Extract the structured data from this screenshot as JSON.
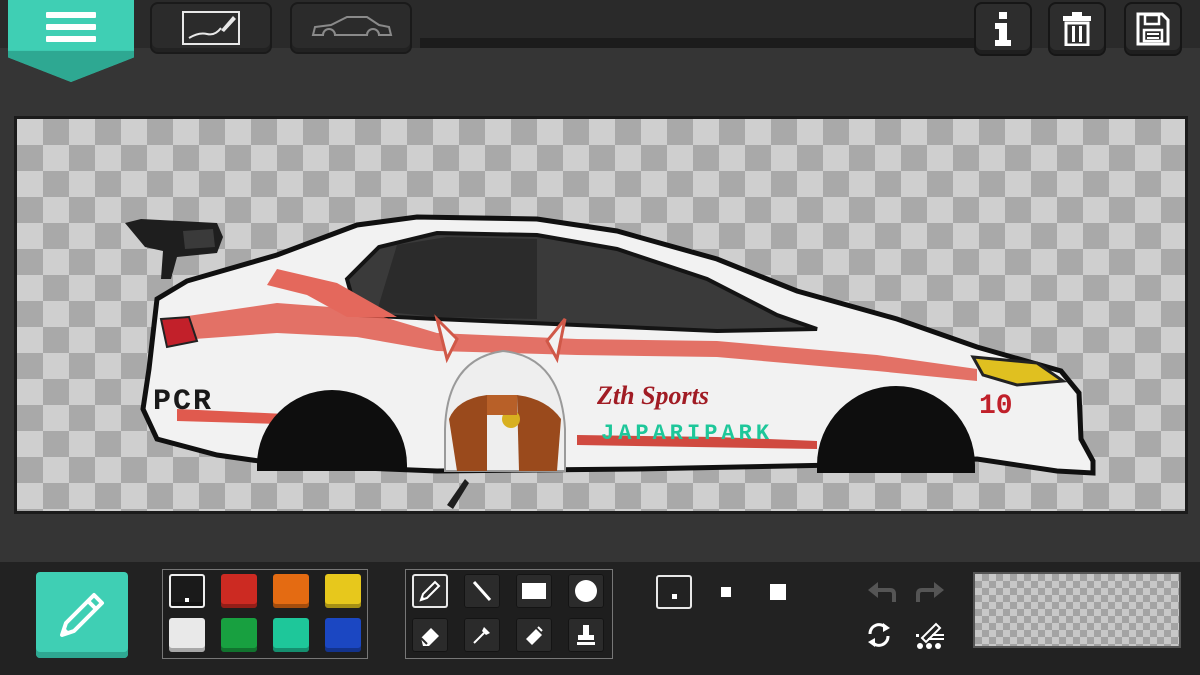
{
  "app": {
    "accent_color": "#3fcfb4",
    "background_color": "#353535"
  },
  "toolbar": {
    "menu_icon": "hamburger-menu-icon",
    "buttons": [
      {
        "name": "draw-mode",
        "icon": "line-drawing-icon"
      },
      {
        "name": "car-template",
        "icon": "car-outline-icon"
      },
      {
        "name": "info",
        "icon": "info-icon"
      },
      {
        "name": "delete",
        "icon": "trash-icon"
      },
      {
        "name": "save",
        "icon": "floppy-disk-icon"
      }
    ]
  },
  "canvas": {
    "background": "transparent-checkerboard",
    "livery": {
      "sponsor_text": "Zth Sports",
      "side_text": "JAPARIPARK",
      "rear_text": "PCR",
      "car_number": "10"
    }
  },
  "palette": {
    "colors": [
      {
        "name": "black",
        "hex": "#1a1a1a",
        "selected": true
      },
      {
        "name": "red",
        "hex": "#cc2a22",
        "selected": false
      },
      {
        "name": "orange",
        "hex": "#e46b12",
        "selected": false
      },
      {
        "name": "yellow",
        "hex": "#e7c81c",
        "selected": false
      },
      {
        "name": "white",
        "hex": "#e9e9e9",
        "selected": false
      },
      {
        "name": "green",
        "hex": "#18a040",
        "selected": false
      },
      {
        "name": "teal",
        "hex": "#1ec79a",
        "selected": false
      },
      {
        "name": "blue",
        "hex": "#1b47c2",
        "selected": false
      }
    ]
  },
  "tools": [
    {
      "name": "pencil",
      "icon": "pencil-icon",
      "selected": true
    },
    {
      "name": "line",
      "icon": "line-icon",
      "selected": false
    },
    {
      "name": "rectangle",
      "icon": "rectangle-icon",
      "selected": false
    },
    {
      "name": "circle",
      "icon": "circle-icon",
      "selected": false
    },
    {
      "name": "eraser",
      "icon": "eraser-icon",
      "selected": false
    },
    {
      "name": "eyedropper",
      "icon": "eyedropper-icon",
      "selected": false
    },
    {
      "name": "fill",
      "icon": "paint-bucket-icon",
      "selected": false
    },
    {
      "name": "stamp",
      "icon": "stamp-icon",
      "selected": false
    }
  ],
  "brush_sizes": [
    {
      "name": "small",
      "selected": true
    },
    {
      "name": "medium",
      "selected": false
    },
    {
      "name": "large",
      "selected": false
    }
  ],
  "history": {
    "undo_icon": "undo-arrow-icon",
    "redo_icon": "redo-arrow-icon",
    "rotate_icon": "rotate-icon",
    "dither_icon": "dither-brush-icon"
  }
}
